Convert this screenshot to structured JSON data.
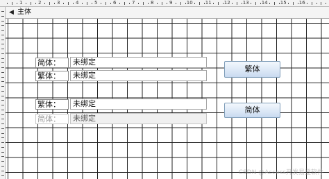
{
  "ruler": {
    "numbers": [
      "1",
      "2",
      "3",
      "4",
      "5",
      "6",
      "7",
      "8",
      "9",
      "10",
      "11",
      "12",
      "13",
      "14",
      "15",
      "16"
    ]
  },
  "section": {
    "icon": "expand-arrow-icon",
    "title": "主体"
  },
  "row1": {
    "label": "简体：",
    "field": "未绑定"
  },
  "row2": {
    "label": "繁体：",
    "field": "未绑定"
  },
  "button_traditional": {
    "label": "繁体"
  },
  "row3": {
    "label": "繁体：",
    "field": "未绑定"
  },
  "row4": {
    "label": "简体：",
    "field": "未绑定"
  },
  "button_simplified": {
    "label": "简体"
  },
  "watermark": "CSDN @Access开发易登软件",
  "colors": {
    "grid_line": "#222222",
    "button_border": "#7f9db9",
    "button_fill": "#dce8f6"
  }
}
